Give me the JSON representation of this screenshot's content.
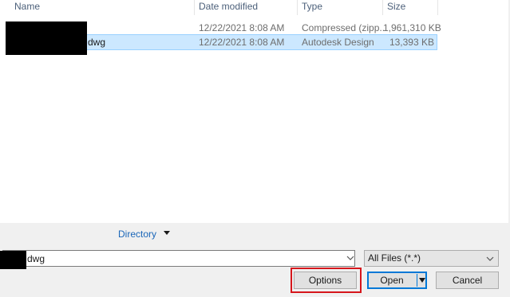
{
  "columns": {
    "name": "Name",
    "date_modified": "Date modified",
    "type": "Type",
    "size": "Size"
  },
  "files": [
    {
      "name": "",
      "date_modified": "12/22/2021 8:08 AM",
      "type": "Compressed (zipp...",
      "size": "1,961,310 KB",
      "selected": false
    },
    {
      "name": "dwg",
      "date_modified": "12/22/2021 8:08 AM",
      "type": "Autodesk Design",
      "size": "13,393 KB",
      "selected": true
    }
  ],
  "directory": {
    "label": "Directory"
  },
  "filename": {
    "value": "dwg"
  },
  "filetype": {
    "selected": "All Files (*.*)"
  },
  "buttons": {
    "options": "Options",
    "open": "Open",
    "cancel": "Cancel"
  },
  "colors": {
    "selection_bg": "#cce8ff",
    "selection_border": "#99d1ff",
    "highlight": "#d6161c",
    "link": "#1a66b8",
    "accent": "#0078d7"
  }
}
